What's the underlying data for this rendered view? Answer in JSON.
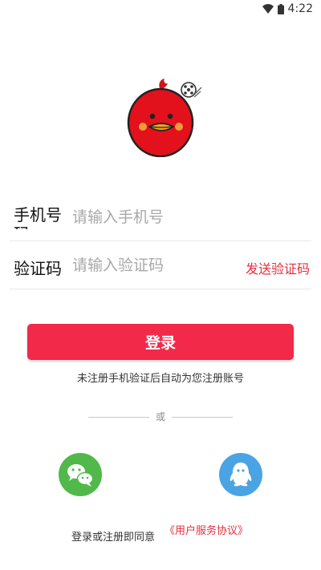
{
  "status_bar": {
    "time": "4:22",
    "wifi_icon": "wifi-icon",
    "battery_icon": "battery-icon"
  },
  "logo": {
    "icon": "bird-mascot-icon"
  },
  "form": {
    "phone_label": "手机号码",
    "phone_placeholder": "请输入手机号",
    "code_label": "验证码",
    "code_placeholder": "请输入验证码",
    "send_code": "发送验证码"
  },
  "login_button": "登录",
  "hint": "未注册手机验证后自动为您注册账号",
  "divider_text": "或",
  "social": {
    "wechat_icon": "wechat-icon",
    "qq_icon": "qq-icon"
  },
  "agreement": {
    "prefix": "登录或注册即同意",
    "link": "《用户服务协议》"
  },
  "colors": {
    "accent": "#f22949",
    "link": "#e62e3c",
    "wechat": "#51b84a",
    "qq": "#4aa4e3"
  }
}
